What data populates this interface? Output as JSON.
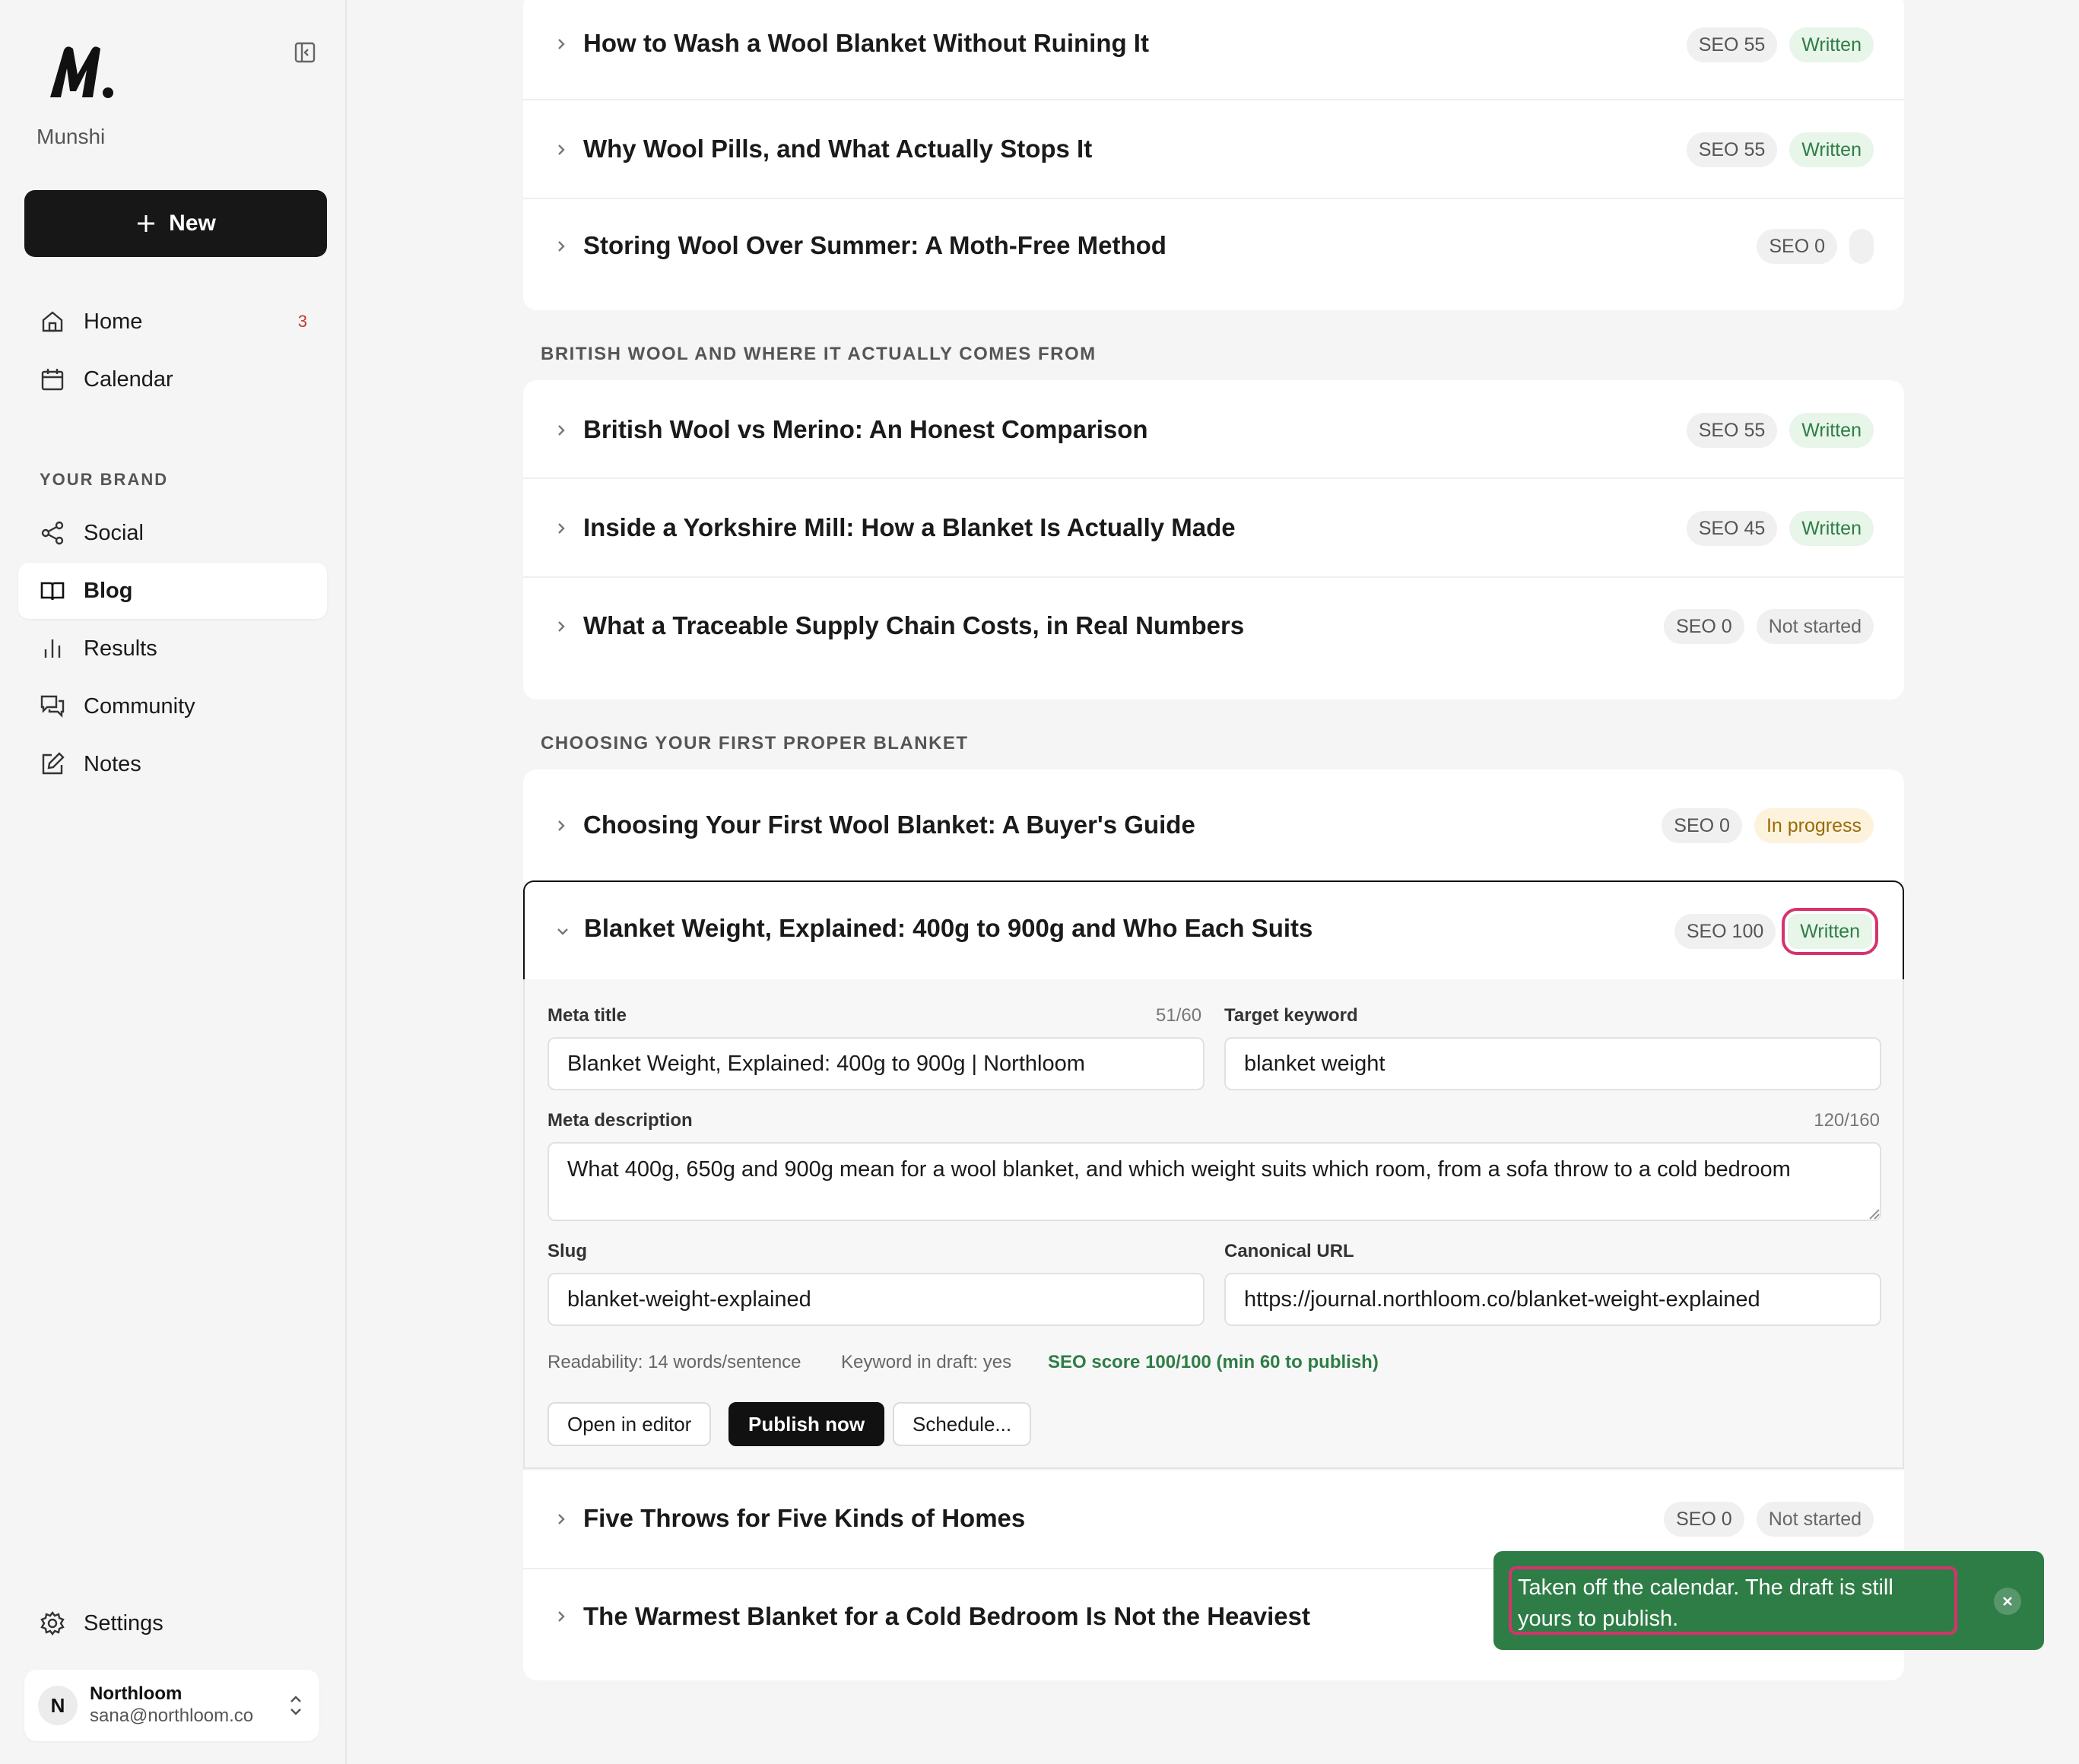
{
  "app": {
    "brand_name": "Munshi",
    "new_label": "New"
  },
  "sidebar": {
    "home_label": "Home",
    "home_badge": "3",
    "calendar_label": "Calendar",
    "section_label": "YOUR BRAND",
    "social_label": "Social",
    "blog_label": "Blog",
    "results_label": "Results",
    "community_label": "Community",
    "notes_label": "Notes",
    "settings_label": "Settings"
  },
  "account": {
    "initial": "N",
    "name": "Northloom",
    "email": "sana@northloom.co"
  },
  "groups": {
    "top_rows": [
      {
        "title": "How to Wash a Wool Blanket Without Ruining It",
        "seo": "SEO 55",
        "status": "Written"
      },
      {
        "title": "Why Wool Pills, and What Actually Stops It",
        "seo": "SEO 55",
        "status": "Written"
      },
      {
        "title": "Storing Wool Over Summer: A Moth-Free Method",
        "seo": "SEO 0",
        "status": ""
      }
    ],
    "british_label": "BRITISH WOOL AND WHERE IT ACTUALLY COMES FROM",
    "british_rows": [
      {
        "title": "British Wool vs Merino: An Honest Comparison",
        "seo": "SEO 55",
        "status": "Written"
      },
      {
        "title": "Inside a Yorkshire Mill: How a Blanket Is Actually Made",
        "seo": "SEO 45",
        "status": "Written"
      },
      {
        "title": "What a Traceable Supply Chain Costs, in Real Numbers",
        "seo": "SEO 0",
        "status": "Not started"
      }
    ],
    "choosing_label": "CHOOSING YOUR FIRST PROPER BLANKET",
    "choosing_rows": [
      {
        "title": "Choosing Your First Wool Blanket: A Buyer's Guide",
        "seo": "SEO 0",
        "status": "In progress"
      }
    ],
    "expanded": {
      "title": "Blanket Weight, Explained: 400g to 900g and Who Each Suits",
      "seo": "SEO 100",
      "status": "Written"
    },
    "after_rows": [
      {
        "title": "Five Throws for Five Kinds of Homes",
        "seo": "SEO 0",
        "status": "Not started"
      },
      {
        "title": "The Warmest Blanket for a Cold Bedroom Is Not the Heaviest",
        "seo": "",
        "status": ""
      }
    ]
  },
  "editor": {
    "meta_title_label": "Meta title",
    "meta_title_count": "51/60",
    "meta_title_value": "Blanket Weight, Explained: 400g to 900g | Northloom",
    "keyword_label": "Target keyword",
    "keyword_value": "blanket weight",
    "meta_desc_label": "Meta description",
    "meta_desc_count": "120/160",
    "meta_desc_value": "What 400g, 650g and 900g mean for a wool blanket, and which weight suits which room, from a sofa throw to a cold bedroom",
    "slug_label": "Slug",
    "slug_value": "blanket-weight-explained",
    "canonical_label": "Canonical URL",
    "canonical_value": "https://journal.northloom.co/blanket-weight-explained",
    "readability": "Readability: 14 words/sentence",
    "keyword_in_draft": "Keyword in draft: yes",
    "seo_score": "SEO score 100/100 (min 60 to publish)",
    "open_editor_label": "Open in editor",
    "publish_label": "Publish now",
    "schedule_label": "Schedule..."
  },
  "toast": {
    "message": "Taken off the calendar. The draft is still yours to publish.",
    "close_icon": "close-icon"
  },
  "colors": {
    "accent_green": "#2e7d46",
    "highlight": "#d6336c",
    "primary_dark": "#111111"
  }
}
